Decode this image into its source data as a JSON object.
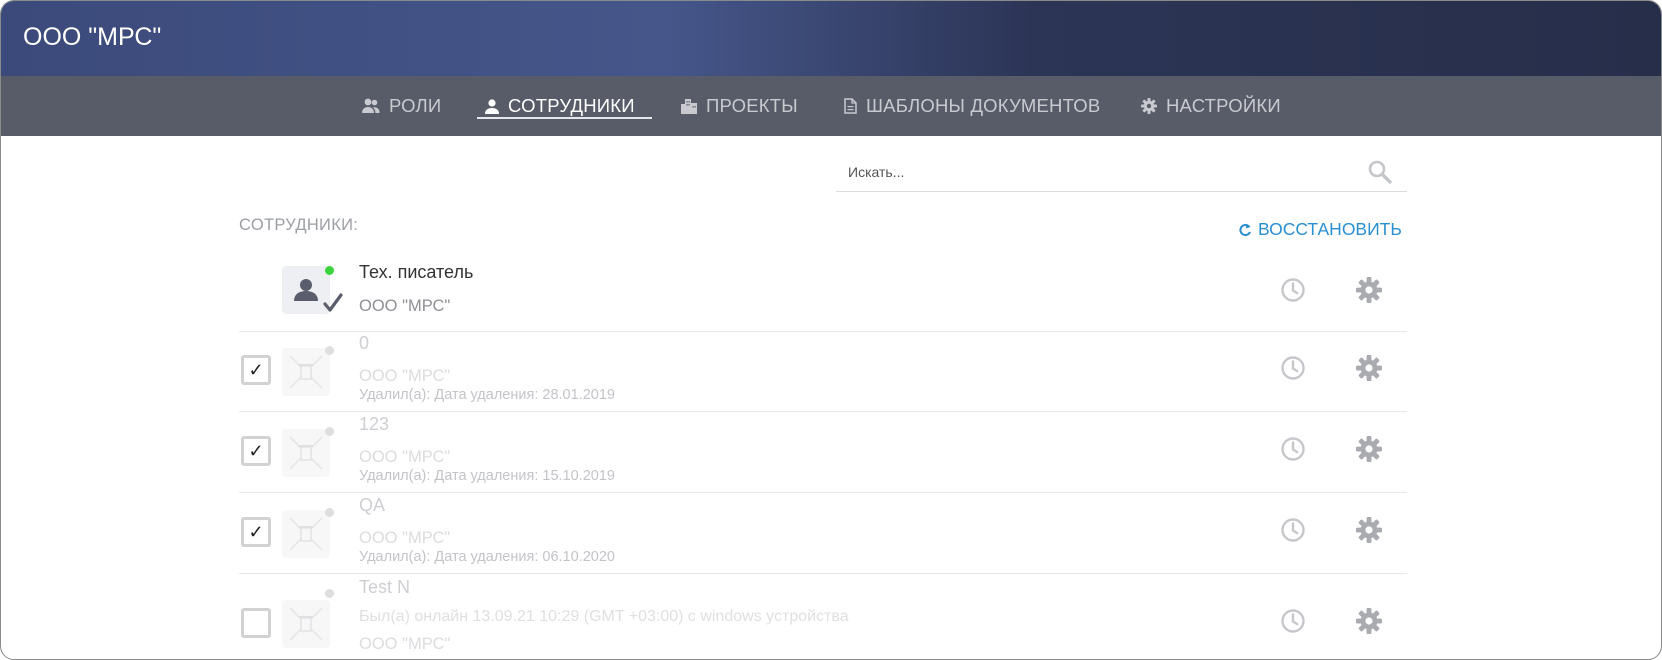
{
  "app": {
    "title": "ООО \"МРС\""
  },
  "nav": {
    "items": [
      {
        "label": "РОЛИ",
        "icon": "users-icon"
      },
      {
        "label": "СОТРУДНИКИ",
        "icon": "user-icon",
        "active": true
      },
      {
        "label": "ПРОЕКТЫ",
        "icon": "building-icon"
      },
      {
        "label": "ШАБЛОНЫ ДОКУМЕНТОВ",
        "icon": "document-icon"
      },
      {
        "label": "НАСТРОЙКИ",
        "icon": "gear-icon"
      }
    ]
  },
  "search": {
    "placeholder": "Искать...",
    "value": ""
  },
  "section": {
    "label": "СОТРУДНИКИ:",
    "restore_label": "ВОССТАНОВИТЬ"
  },
  "colors": {
    "accent": "#2a8fd1",
    "online": "#3cd43c",
    "header_dark": "#272e4a",
    "nav_bg": "#575c68"
  },
  "employees": [
    {
      "name": "Тех. писатель",
      "org": "ООО \"МРС\"",
      "online": true,
      "selected_mark": true,
      "deleted": false
    },
    {
      "name": "0",
      "org": "ООО \"МРС\"",
      "deleted_info": "Удалил(а): Дата удаления: 28.01.2019",
      "deleted": true,
      "checked": true,
      "checkmark": "✓"
    },
    {
      "name": "123",
      "org": "ООО \"МРС\"",
      "deleted_info": "Удалил(а): Дата удаления: 15.10.2019",
      "deleted": true,
      "checked": true,
      "checkmark": "✓"
    },
    {
      "name": "QA",
      "org": "ООО \"МРС\"",
      "deleted_info": "Удалил(а): Дата удаления: 06.10.2020",
      "deleted": true,
      "checked": true,
      "checkmark": "✓"
    },
    {
      "name": "Test N",
      "last_seen": "Был(а) онлайн 13.09.21 10:29 (GMT +03:00) с windows устройства",
      "org": "ООО \"МРС\"",
      "deleted": true,
      "checked": false,
      "checkmark": ""
    }
  ]
}
